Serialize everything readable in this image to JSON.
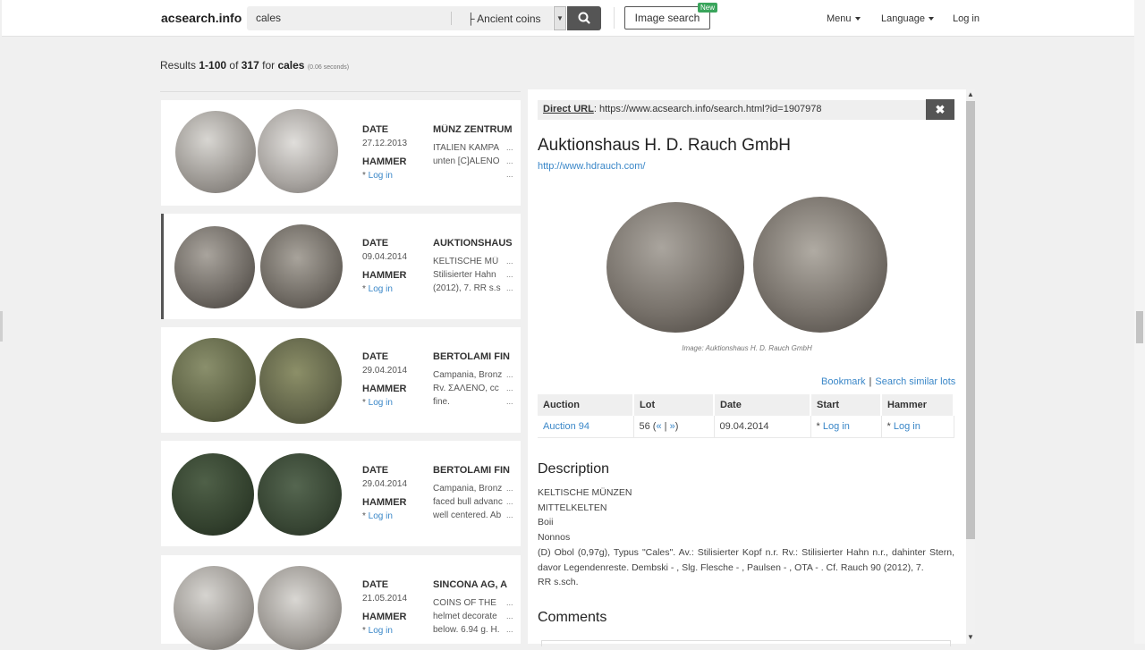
{
  "header": {
    "brand": "acsearch.info",
    "search_value": "cales",
    "category": "├ Ancient coins",
    "image_search": "Image search",
    "new_badge": "New",
    "menu": "Menu",
    "language": "Language",
    "login": "Log in"
  },
  "results": {
    "prefix": "Results ",
    "range": "1-100",
    "of": " of ",
    "total": "317",
    "for": " for ",
    "query": "cales",
    "time": "(0.06 seconds)"
  },
  "labels": {
    "date": "DATE",
    "hammer": "HAMMER",
    "login": "Log in",
    "star": "* ",
    "ellipsis": "..."
  },
  "items": [
    {
      "date": "27.12.2013",
      "auctioneer": "MÜNZ ZENTRUM",
      "lines": [
        "ITALIEN KAMPA",
        "unten [C]ALENO",
        ""
      ]
    },
    {
      "date": "09.04.2014",
      "auctioneer": "AUKTIONSHAUS",
      "lines": [
        "KELTISCHE  MÜ",
        "Stilisierter Hahn",
        "(2012), 7. RR s.s"
      ]
    },
    {
      "date": "29.04.2014",
      "auctioneer": "BERTOLAMI FIN",
      "lines": [
        "Campania, Bronz",
        "Rv. ΣΑΛΕΝΟ, cc",
        "fine."
      ]
    },
    {
      "date": "29.04.2014",
      "auctioneer": "BERTOLAMI FIN",
      "lines": [
        "Campania, Bronz",
        "faced bull advanc",
        "well centered. Ab"
      ]
    },
    {
      "date": "21.05.2014",
      "auctioneer": "SINCONA AG, A",
      "lines": [
        "COINS OF THE",
        "helmet decorate",
        "below. 6.94 g. H."
      ]
    }
  ],
  "detail": {
    "url_label": "Direct URL",
    "url_sep": ": ",
    "url": "https://www.acsearch.info/search.html?id=1907978",
    "close": "✖",
    "title": "Auktionshaus H. D. Rauch GmbH",
    "website": "http://www.hdrauch.com/",
    "caption": "Image: Auktionshaus H. D. Rauch GmbH",
    "bookmark": "Bookmark",
    "action_sep": "|",
    "similar": "Search similar lots",
    "table_headers": [
      "Auction",
      "Lot",
      "Date",
      "Start",
      "Hammer"
    ],
    "auction": "Auction 94",
    "lot_num": "56 (",
    "lot_prev": "«",
    "lot_mid": " | ",
    "lot_next": "»",
    "lot_end": ")",
    "date": "09.04.2014",
    "start": "Log in",
    "hammer": "Log in",
    "description_heading": "Description",
    "description_lines": [
      "KELTISCHE MÜNZEN",
      "MITTELKELTEN",
      "Boii",
      "Nonnos",
      "(D) Obol (0,97g), Typus \"Cales\". Av.: Stilisierter Kopf n.r. Rv.: Stilisierter Hahn n.r., dahinter Stern, davor Legendenreste. Dembski - , Slg. Flesche - , Paulsen - , OTA - . Cf. Rauch 90 (2012), 7.",
      "RR s.sch."
    ],
    "comments_heading": "Comments"
  },
  "colors": {
    "accent": "#3a87c8",
    "dark_button": "#555555",
    "badge": "#3aa55c"
  },
  "icons": {
    "search": "search-icon",
    "close": "close-icon"
  }
}
